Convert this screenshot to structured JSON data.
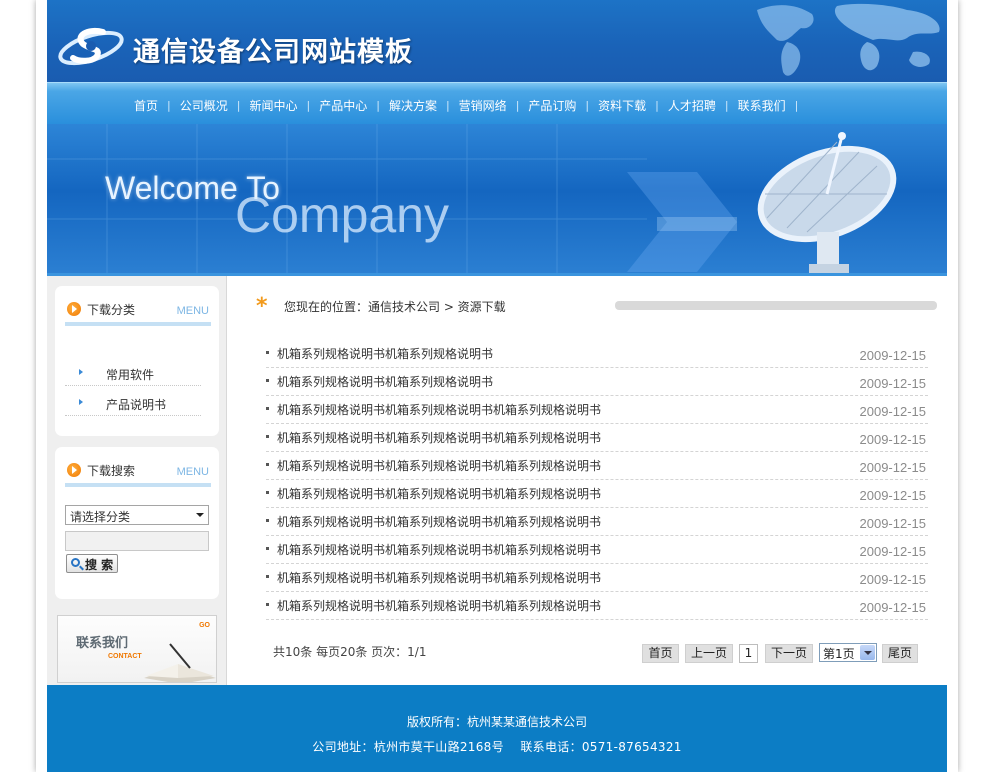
{
  "header": {
    "site_title": "通信设备公司网站模板"
  },
  "nav": {
    "items": [
      "首页",
      "公司概况",
      "新闻中心",
      "产品中心",
      "解决方案",
      "营销网络",
      "产品订购",
      "资料下载",
      "人才招聘",
      "联系我们"
    ]
  },
  "banner": {
    "line1": "Welcome To",
    "line2": "Company"
  },
  "sidebar": {
    "download_category": {
      "title": "下载分类",
      "menu_tag": "MENU",
      "items": [
        "常用软件",
        "产品说明书"
      ]
    },
    "download_search": {
      "title": "下载搜索",
      "menu_tag": "MENU",
      "select_value": "请选择分类",
      "button_label": "搜 索"
    },
    "contact": {
      "title": "联系我们",
      "subtitle": "CONTACT",
      "go": "GO"
    }
  },
  "main": {
    "breadcrumb": "您现在的位置：通信技术公司 > 资源下载",
    "rows": [
      {
        "title": "机箱系列规格说明书机箱系列规格说明书",
        "date": "2009-12-15"
      },
      {
        "title": "机箱系列规格说明书机箱系列规格说明书",
        "date": "2009-12-15"
      },
      {
        "title": "机箱系列规格说明书机箱系列规格说明书机箱系列规格说明书",
        "date": "2009-12-15"
      },
      {
        "title": "机箱系列规格说明书机箱系列规格说明书机箱系列规格说明书",
        "date": "2009-12-15"
      },
      {
        "title": "机箱系列规格说明书机箱系列规格说明书机箱系列规格说明书",
        "date": "2009-12-15"
      },
      {
        "title": "机箱系列规格说明书机箱系列规格说明书机箱系列规格说明书",
        "date": "2009-12-15"
      },
      {
        "title": "机箱系列规格说明书机箱系列规格说明书机箱系列规格说明书",
        "date": "2009-12-15"
      },
      {
        "title": "机箱系列规格说明书机箱系列规格说明书机箱系列规格说明书",
        "date": "2009-12-15"
      },
      {
        "title": "机箱系列规格说明书机箱系列规格说明书机箱系列规格说明书",
        "date": "2009-12-15"
      },
      {
        "title": "机箱系列规格说明书机箱系列规格说明书机箱系列规格说明书",
        "date": "2009-12-15"
      }
    ],
    "pager": {
      "info": "共10条 每页20条 页次：1/1",
      "first": "首页",
      "prev": "上一页",
      "current": "1",
      "next": "下一页",
      "select_value": "第1页",
      "last": "尾页"
    }
  },
  "footer": {
    "copyright": "版权所有：杭州某某通信技术公司",
    "address_contact": "公司地址：杭州市莫干山路2168号    联系电话：0571-87654321"
  },
  "colors": {
    "brand_blue": "#1a63b8",
    "nav_blue": "#2a8fdc",
    "footer_blue": "#0c7dc5",
    "accent_orange": "#f07800"
  }
}
